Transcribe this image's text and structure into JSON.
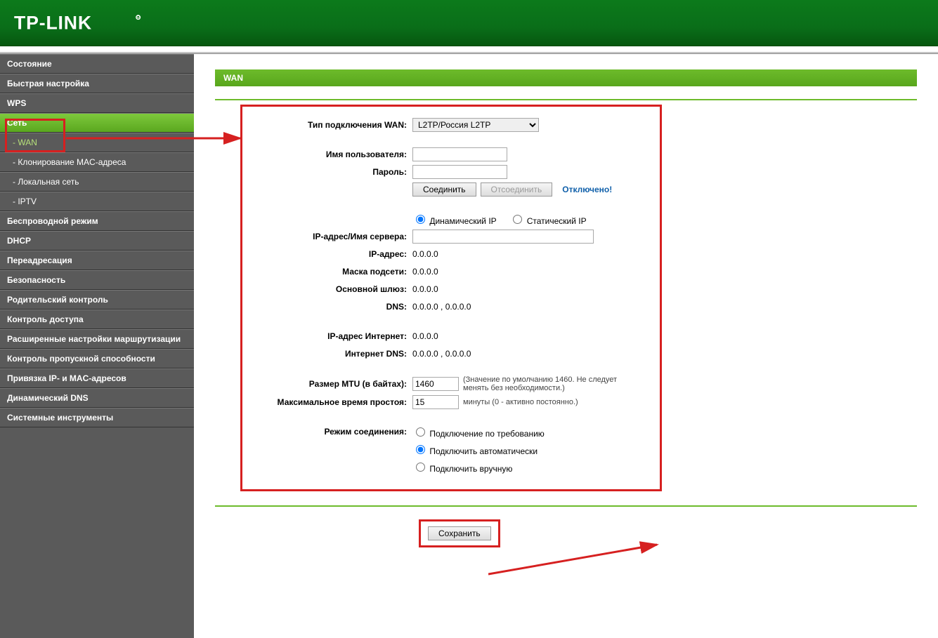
{
  "brand": "TP-LINK",
  "sidebar": {
    "items": [
      {
        "label": "Состояние"
      },
      {
        "label": "Быстрая настройка"
      },
      {
        "label": "WPS"
      },
      {
        "label": "Сеть",
        "active": true
      },
      {
        "label": "- WAN",
        "sub": true,
        "subactive": true
      },
      {
        "label": "- Клонирование MAC-адреса",
        "sub": true
      },
      {
        "label": "- Локальная сеть",
        "sub": true
      },
      {
        "label": "- IPTV",
        "sub": true
      },
      {
        "label": "Беспроводной режим"
      },
      {
        "label": "DHCP"
      },
      {
        "label": "Переадресация"
      },
      {
        "label": "Безопасность"
      },
      {
        "label": "Родительский контроль"
      },
      {
        "label": "Контроль доступа"
      },
      {
        "label": "Расширенные настройки маршрутизации"
      },
      {
        "label": "Контроль пропускной способности"
      },
      {
        "label": "Привязка IP- и MAC-адресов"
      },
      {
        "label": "Динамический DNS"
      },
      {
        "label": "Системные инструменты"
      }
    ]
  },
  "page": {
    "title": "WAN"
  },
  "form": {
    "conn_type_label": "Тип подключения WAN:",
    "conn_type_value": "L2TP/Россия L2TP",
    "username_label": "Имя пользователя:",
    "username_value": "",
    "password_label": "Пароль:",
    "password_value": "",
    "connect_btn": "Соединить",
    "disconnect_btn": "Отсоединить",
    "status": "Отключено!",
    "ip_mode_dynamic": "Динамический IP",
    "ip_mode_static": "Статический IP",
    "server_label": "IP-адрес/Имя сервера:",
    "server_value": "",
    "ip_label": "IP-адрес:",
    "ip_value": "0.0.0.0",
    "mask_label": "Маска подсети:",
    "mask_value": "0.0.0.0",
    "gw_label": "Основной шлюз:",
    "gw_value": "0.0.0.0",
    "dns_label": "DNS:",
    "dns_value": "0.0.0.0 , 0.0.0.0",
    "inet_ip_label": "IP-адрес Интернет:",
    "inet_ip_value": "0.0.0.0",
    "inet_dns_label": "Интернет DNS:",
    "inet_dns_value": "0.0.0.0 , 0.0.0.0",
    "mtu_label": "Размер MTU (в байтах):",
    "mtu_value": "1460",
    "mtu_hint": "(Значение по умолчанию 1460. Не следует менять без необходимости.)",
    "idle_label": "Максимальное время простоя:",
    "idle_value": "15",
    "idle_hint": "минуты (0 - активно постоянно.)",
    "mode_label": "Режим соединения:",
    "mode_ondemand": "Подключение по требованию",
    "mode_auto": "Подключить автоматически",
    "mode_manual": "Подключить вручную",
    "save_btn": "Сохранить"
  }
}
